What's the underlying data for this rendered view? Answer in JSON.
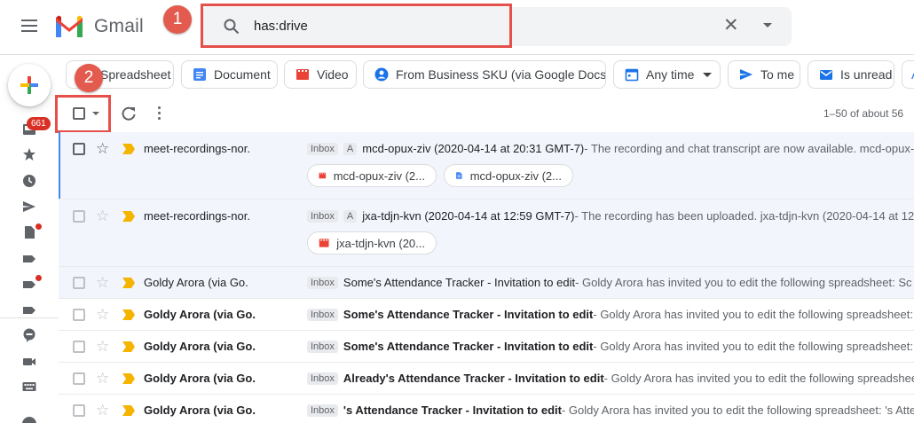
{
  "header": {
    "app_name": "Gmail",
    "search_query": "has:drive"
  },
  "annotations": [
    "1",
    "2"
  ],
  "compose_colors": [
    "#ea4335",
    "#fbbc04",
    "#34a853",
    "#4285f4"
  ],
  "sidebar": {
    "inbox_count": "661"
  },
  "chips": [
    {
      "label": "Spreadsheet",
      "icon": "spreadsheet-icon"
    },
    {
      "label": "Document",
      "icon": "document-icon"
    },
    {
      "label": "Video",
      "icon": "video-icon"
    },
    {
      "label": "From Business SKU (via Google Docs)",
      "icon": "person-icon"
    },
    {
      "label": "Any time",
      "icon": "calendar-icon"
    },
    {
      "label": "To me",
      "icon": "send-icon"
    },
    {
      "label": "Is unread",
      "icon": "unread-mail-icon"
    }
  ],
  "toolbar": {
    "pagination": "1–50 of about 56"
  },
  "emails": [
    {
      "sender": "meet-recordings-nor.",
      "label": "Inbox",
      "tag": "A",
      "subject": "mcd-opux-ziv (2020-04-14 at 20:31 GMT-7)",
      "snippet": " - The recording and chat transcript are now available. mcd-opux-",
      "attachments": [
        {
          "icon": "video-file-icon",
          "text": "mcd-opux-ziv (2..."
        },
        {
          "icon": "doc-file-icon",
          "text": "mcd-opux-ziv (2..."
        }
      ]
    },
    {
      "sender": "meet-recordings-nor.",
      "label": "Inbox",
      "tag": "A",
      "subject": "jxa-tdjn-kvn (2020-04-14 at 12:59 GMT-7)",
      "snippet": " - The recording has been uploaded. jxa-tdjn-kvn (2020-04-14 at 12:",
      "attachments": [
        {
          "icon": "video-file-icon",
          "text": "jxa-tdjn-kvn (20..."
        }
      ]
    },
    {
      "sender": "Goldy Arora (via Go.",
      "label": "Inbox",
      "subject": "Some's Attendance Tracker - Invitation to edit",
      "snippet": " - Goldy Arora has invited you to edit the following spreadsheet: Sc"
    },
    {
      "sender": "Goldy Arora (via Go.",
      "label": "Inbox",
      "subject": "Some's Attendance Tracker - Invitation to edit",
      "snippet": " - Goldy Arora has invited you to edit the following spreadsheet: S"
    },
    {
      "sender": "Goldy Arora (via Go.",
      "label": "Inbox",
      "subject": "Some's Attendance Tracker - Invitation to edit",
      "snippet": " - Goldy Arora has invited you to edit the following spreadsheet: S"
    },
    {
      "sender": "Goldy Arora (via Go.",
      "label": "Inbox",
      "subject": "Already's Attendance Tracker - Invitation to edit",
      "snippet": " - Goldy Arora has invited you to edit the following spreadsheet: A"
    },
    {
      "sender": "Goldy Arora (via Go.",
      "label": "Inbox",
      "subject": "'s Attendance Tracker - Invitation to edit",
      "snippet": " - Goldy Arora has invited you to edit the following spreadsheet: 's Atte"
    }
  ]
}
